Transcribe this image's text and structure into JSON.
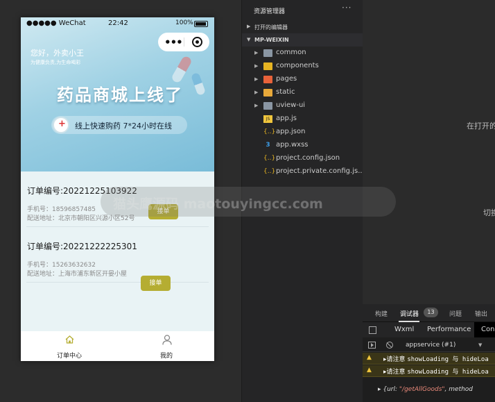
{
  "phone": {
    "status": {
      "signal": "●●●●● WeChat",
      "time": "22:42",
      "battery": "100%"
    },
    "banner": {
      "greeting": "您好，外卖小王",
      "sub": "为健康负责,为生命喝彩",
      "headline": "药品商城上线了",
      "pill": "线上快速购药  7*24小时在线"
    },
    "orders": [
      {
        "title": "订单编号:20221225103922",
        "phone": "手机号：18596857485",
        "address": "配送地址：北京市朝阳区兴源小区52号",
        "button": "接单"
      },
      {
        "title": "订单编号:20221222225301",
        "phone": "手机号：15263632632",
        "address": "配送地址：上海市浦东新区开晏小屋",
        "button": "接单"
      }
    ],
    "tabbar": [
      {
        "label": "订单中心",
        "icon": "home-icon",
        "color": "#b5ad32"
      },
      {
        "label": "我的",
        "icon": "user-icon",
        "color": "#888888"
      }
    ]
  },
  "explorer": {
    "title": "资源管理器",
    "more": "···",
    "open_editors": "打开的编辑器",
    "project": "MP-WEIXIN",
    "items": [
      {
        "name": "common",
        "type": "folder",
        "icon": "folder-icon",
        "expandable": true
      },
      {
        "name": "components",
        "type": "folder",
        "icon": "components-folder-icon",
        "expandable": true
      },
      {
        "name": "pages",
        "type": "folder",
        "icon": "pages-folder-icon",
        "expandable": true
      },
      {
        "name": "static",
        "type": "folder",
        "icon": "static-folder-icon",
        "expandable": true
      },
      {
        "name": "uview-ui",
        "type": "folder",
        "icon": "folder-icon",
        "expandable": true
      },
      {
        "name": "app.js",
        "type": "file",
        "icon": "js-file-icon",
        "glyph": "JS"
      },
      {
        "name": "app.json",
        "type": "file",
        "icon": "json-file-icon",
        "glyph": "{..}"
      },
      {
        "name": "app.wxss",
        "type": "file",
        "icon": "wxss-file-icon",
        "glyph": "3"
      },
      {
        "name": "project.config.json",
        "type": "file",
        "icon": "json-file-icon",
        "glyph": "{..}"
      },
      {
        "name": "project.private.config.js...",
        "type": "file",
        "icon": "json-file-icon",
        "glyph": "{..}"
      }
    ]
  },
  "right": {
    "hint_top": "在打开的",
    "hint_bottom": "切换",
    "console": {
      "tabs": [
        "构建",
        "调试器",
        "问题",
        "输出"
      ],
      "active_tab": "调试器",
      "badge": "13",
      "subtabs": [
        "Wxml",
        "Performance",
        "Con"
      ],
      "context": "appservice (#1)",
      "warnings": [
        {
          "prefix": "▸请注意 ",
          "code": "showLoading 与 hideLoa"
        },
        {
          "prefix": "▸请注意 ",
          "code": "showLoading 与 hideLoa"
        }
      ],
      "log_prefix": "▸ {url: ",
      "log_value": "\"/getAllGoods\"",
      "log_suffix": ", method"
    }
  },
  "watermark": "猫头鹰源码 maotouyingcc.com",
  "colors": {
    "accent": "#b5ad32",
    "banner": "#9fd1e4",
    "ide_bg": "#252526"
  }
}
